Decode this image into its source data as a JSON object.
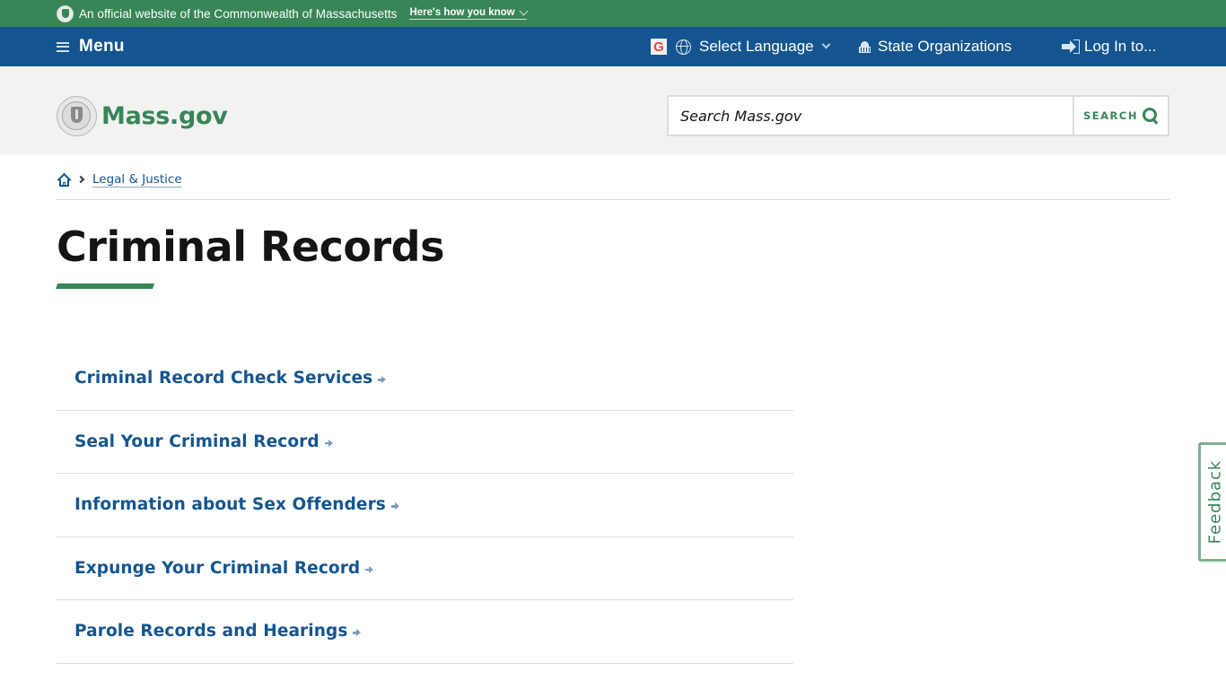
{
  "official_banner": {
    "text": "An official website of the Commonwealth of Massachusetts",
    "how_you_know": "Here's how you know"
  },
  "nav": {
    "menu_label": "Menu",
    "language_label": "Select Language",
    "state_orgs_label": "State Organizations",
    "login_label": "Log In to..."
  },
  "header": {
    "logo_text": "Mass.gov",
    "search_placeholder": "Search Mass.gov",
    "search_value": "",
    "search_button": "SEARCH"
  },
  "breadcrumb": {
    "items": [
      {
        "label": "Legal & Justice"
      }
    ]
  },
  "page": {
    "title": "Criminal Records"
  },
  "links": [
    {
      "label": "Criminal Record Check Services"
    },
    {
      "label": "Seal Your Criminal Record"
    },
    {
      "label": "Information about Sex Offenders"
    },
    {
      "label": "Expunge Your Criminal Record"
    },
    {
      "label": "Parole Records and Hearings"
    }
  ],
  "feedback": {
    "label": "Feedback"
  },
  "colors": {
    "banner_green": "#388557",
    "nav_blue": "#14558f",
    "header_gray": "#f2f2f2",
    "link_blue": "#14558f"
  }
}
